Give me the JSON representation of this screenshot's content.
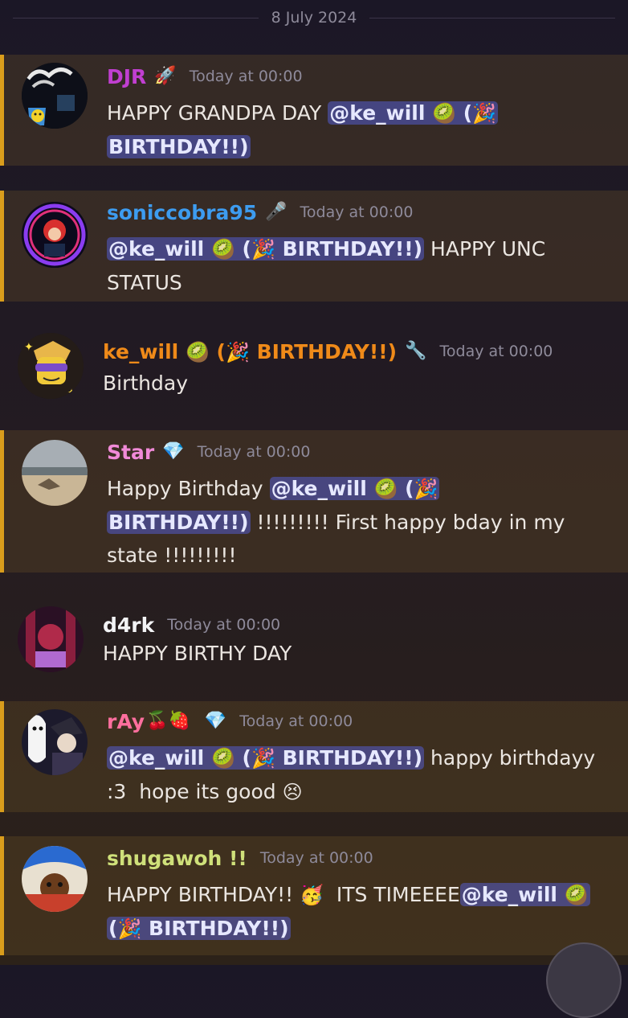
{
  "date_divider": "8 July 2024",
  "colors": {
    "highlight_border": "#d99d1c",
    "mention_bg": "#5865f2",
    "djr": "#c13fd1",
    "soniccobra95": "#3d9cf0",
    "ke_will": "#ef8a19",
    "star": "#f08ad8",
    "d4rk": "#f2f3f5",
    "ray": "#ff6f9e",
    "shugawoh": "#cfe07a"
  },
  "mention": {
    "at": "@ke_will",
    "kiwi": "🥝",
    "open": "(",
    "popper": "🎉",
    "tail": "BIRTHDAY!!)"
  },
  "messages": [
    {
      "author": "DJR",
      "badge": "🚀",
      "time": "Today at 00:00",
      "text_pre": "HAPPY GRANDPA DAY "
    },
    {
      "author": "soniccobra95",
      "badge": "🎤",
      "time": "Today at 00:00",
      "text_post": " HAPPY UNC",
      "text_line2": "STATUS"
    },
    {
      "author_at": "ke_will",
      "author_kiwi": "🥝",
      "author_open": "(",
      "author_popper": "🎉",
      "author_tail": "BIRTHDAY!!)",
      "badge": "🔧",
      "time": "Today at 00:00",
      "text": "Birthday"
    },
    {
      "author": "Star",
      "badge": "💎",
      "time": "Today at 00:00",
      "text_pre": "Happy Birthday ",
      "text_post": " !!!!!!!!! First happy bday in my",
      "text_line3": "state !!!!!!!!!"
    },
    {
      "author": "d4rk",
      "time": "Today at 00:00",
      "text": "HAPPY BIRTHY DAY"
    },
    {
      "author": "rAy",
      "author_emoji": "🍒🍓",
      "badge": "💎",
      "time": "Today at 00:00",
      "text_post": " happy birthdayy",
      "text_line2": ":3  hope its good ",
      "text_emoji": "😣"
    },
    {
      "author": "shugawoh !!",
      "time": "Today at 00:00",
      "text_pre": "HAPPY BIRTHDAY!! ",
      "text_emoji": "🥳",
      "text_mid": "  ITS TIMEEEE"
    }
  ]
}
